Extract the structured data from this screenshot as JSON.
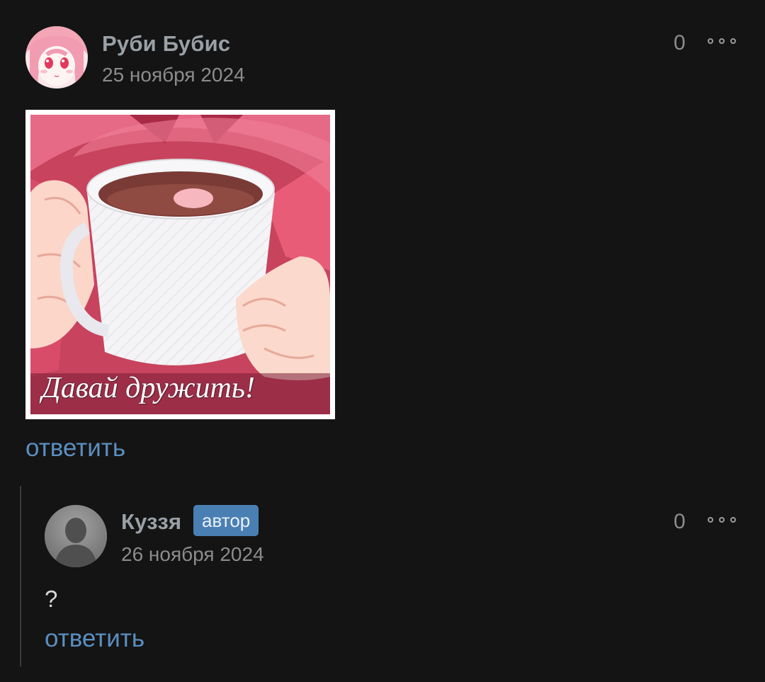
{
  "comments": [
    {
      "author": "Руби Бубис",
      "date": "25 ноября 2024",
      "score": "0",
      "image_caption": "Давай дружить!",
      "reply_label": "ответить",
      "avatar_icon": "anime-girl-avatar-icon",
      "more_icon": "more-options-icon"
    },
    {
      "author": "Куззя",
      "badge": "автор",
      "date": "26 ноября 2024",
      "score": "0",
      "text": "?",
      "reply_label": "ответить",
      "avatar_icon": "default-user-avatar-icon",
      "more_icon": "more-options-icon"
    }
  ],
  "colors": {
    "background": "#141414",
    "link": "#5b8fc0",
    "badge": "#4a7fb3",
    "author": "#9aa0a6",
    "muted": "#8c8c8c"
  }
}
